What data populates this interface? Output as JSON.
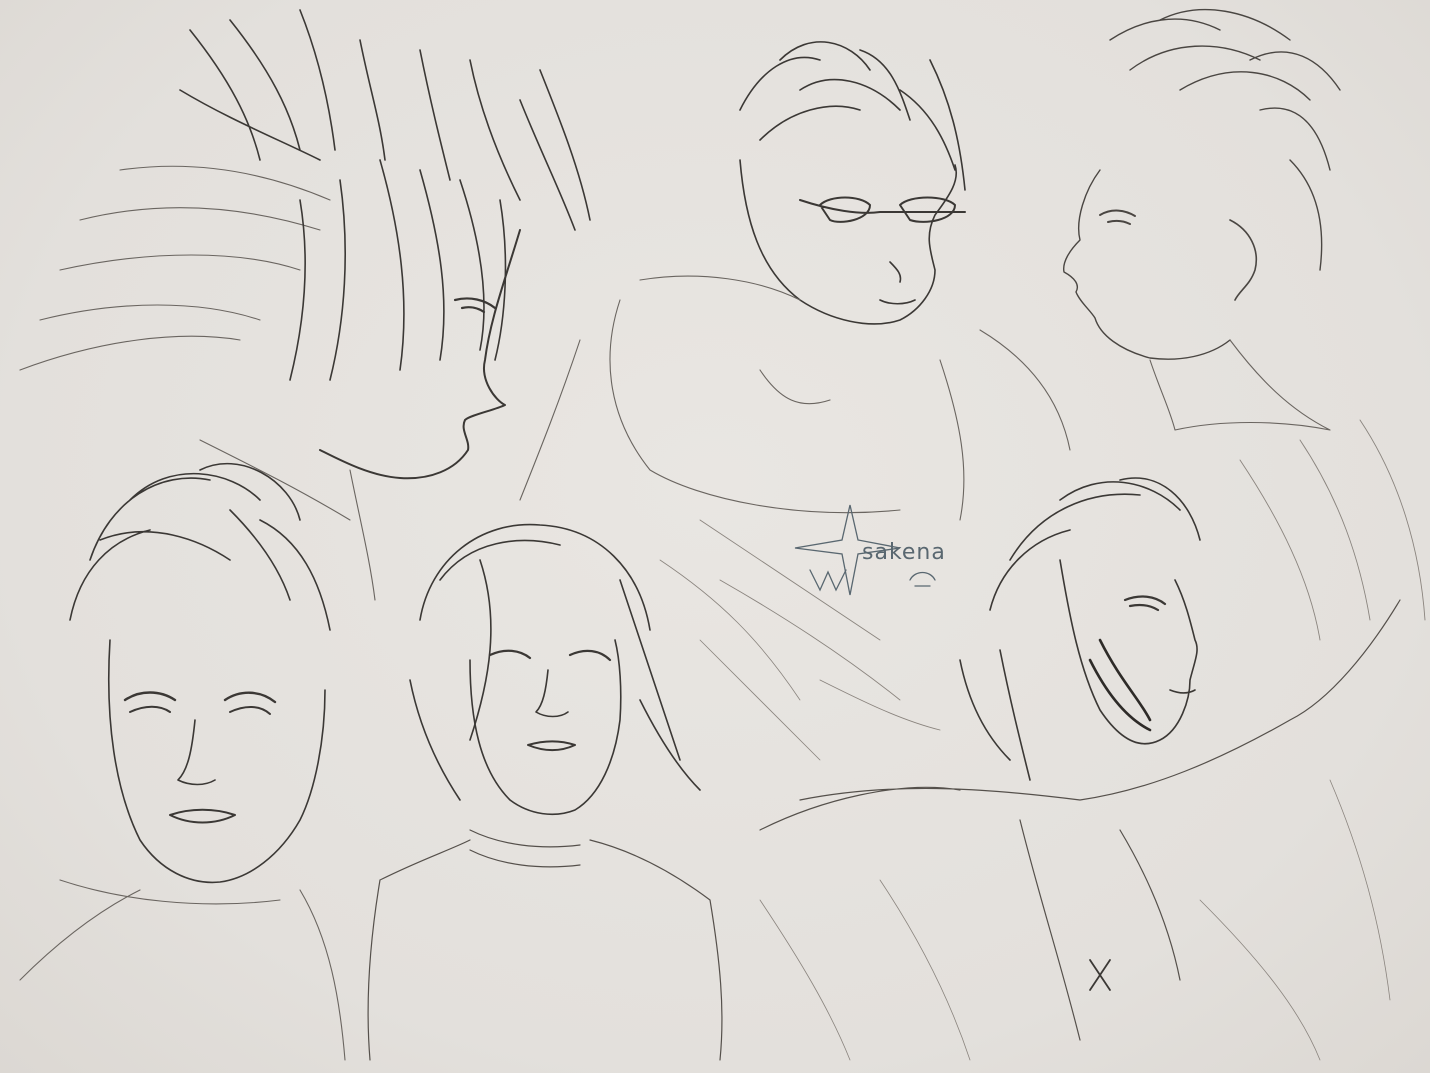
{
  "artwork": {
    "background": "#e6e3df",
    "line_color": "#3b3835",
    "signature_color": "#596770",
    "signature_text": "sakena",
    "medium": "pencil sketch",
    "figures": [
      {
        "name": "head-profile-right-spiky",
        "kind": "profile"
      },
      {
        "name": "head-glasses-three-quarter",
        "kind": "three-quarter"
      },
      {
        "name": "head-profile-left-swept",
        "kind": "profile"
      },
      {
        "name": "head-front-frowning",
        "kind": "front"
      },
      {
        "name": "head-front-short-hair",
        "kind": "front"
      },
      {
        "name": "head-three-quarter-beard",
        "kind": "three-quarter"
      }
    ]
  }
}
